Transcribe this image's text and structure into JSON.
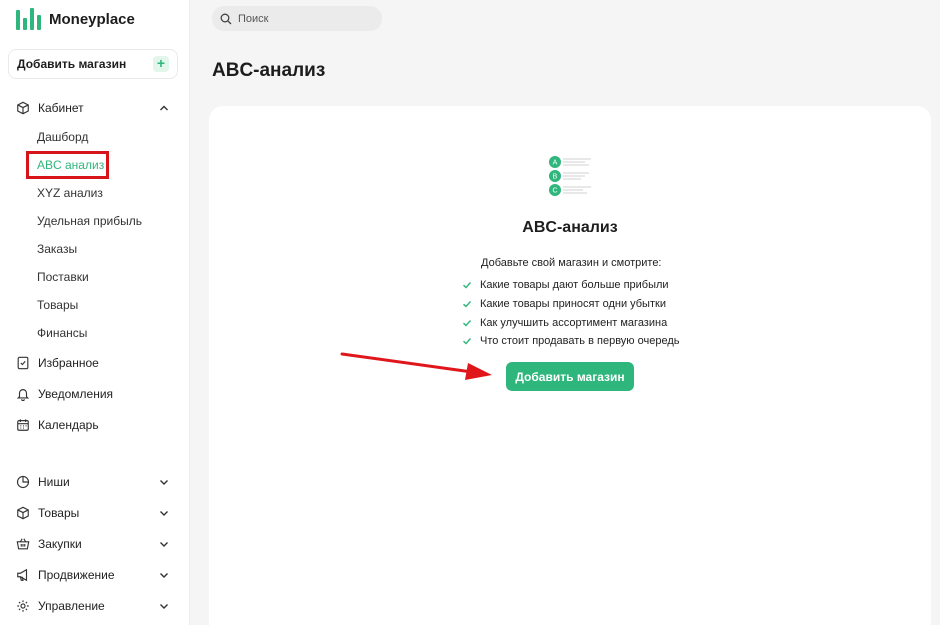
{
  "app": {
    "name": "Moneyplace",
    "brand_color": "#2fb67c",
    "highlight_color": "#d8141b"
  },
  "sidebar": {
    "add_store_label": "Добавить магазин",
    "cabinet": {
      "label": "Кабинет",
      "items": [
        "Дашборд",
        "ABC анализ",
        "XYZ анализ",
        "Удельная прибыль",
        "Заказы",
        "Поставки",
        "Товары",
        "Финансы"
      ],
      "active": "ABC анализ"
    },
    "main_items": [
      "Избранное",
      "Уведомления",
      "Календарь"
    ],
    "groups": [
      "Ниши",
      "Товары",
      "Закупки",
      "Продвижение",
      "Управление"
    ]
  },
  "search": {
    "placeholder": "Поиск"
  },
  "page": {
    "title": "ABC-анализ"
  },
  "card": {
    "illustration_letters": [
      "A",
      "B",
      "C"
    ],
    "title": "ABC-анализ",
    "intro": "Добавьте свой магазин и смотрите:",
    "bullets": [
      "Какие товары дают больше прибыли",
      "Какие товары приносят одни убытки",
      "Как улучшить ассортимент магазина",
      "Что стоит продавать в первую очередь"
    ],
    "cta_label": "Добавить магазин"
  }
}
